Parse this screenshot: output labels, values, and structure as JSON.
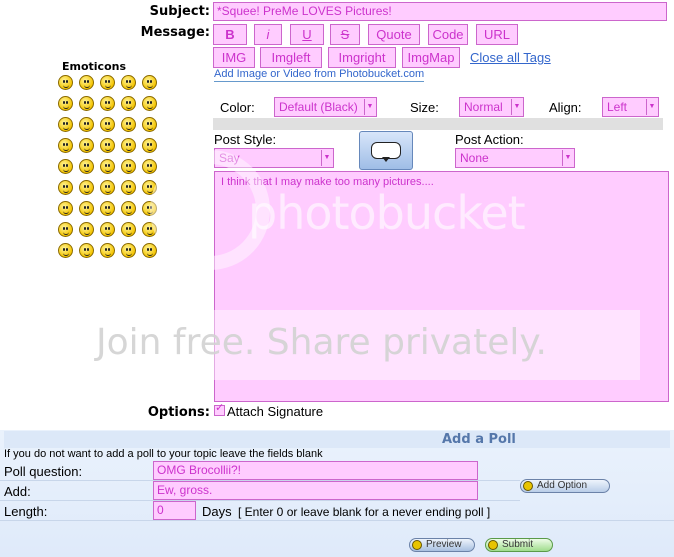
{
  "post": {
    "subject_label": "Subject:",
    "subject_value": "*Squee! PreMe LOVES Pictures!",
    "message_label": "Message:",
    "message_text": "I think that I may make too many pictures....",
    "options_label": "Options:",
    "attach_signature_label": "Attach Signature"
  },
  "tags": {
    "row1": [
      "B",
      "i",
      "U",
      "S",
      "Quote",
      "Code",
      "URL"
    ],
    "row2": [
      "IMG",
      "Imgleft",
      "Imgright",
      "ImgMap"
    ],
    "close_all_label": "Close all Tags",
    "photobucket_link": "Add Image or Video from Photobucket.com"
  },
  "format": {
    "color_label": "Color:",
    "color_value": "Default (Black)",
    "size_label": "Size:",
    "size_value": "Normal",
    "align_label": "Align:",
    "align_value": "Left"
  },
  "post_style": {
    "label": "Post Style:",
    "value": "Say",
    "action_label": "Post Action:",
    "action_value": "None"
  },
  "emoticons": {
    "title": "Emoticons",
    "rows": 9,
    "cols": 5,
    "last_row_count": 5
  },
  "watermark": {
    "line1": "photobucket",
    "line2": "Join free. Share privately."
  },
  "poll": {
    "title": "Add a Poll",
    "note": "If you do not want to add a poll to your topic leave the fields blank",
    "question_label": "Poll question:",
    "question_value": "OMG Brocollii?!",
    "add_label": "Add:",
    "add_value": "Ew, gross.",
    "add_option_label": "Add Option",
    "length_label": "Length:",
    "length_value": "0",
    "days_label": "Days",
    "days_hint": "[ Enter 0 or leave blank for a never ending poll ]"
  },
  "actions": {
    "preview_label": "Preview",
    "submit_label": "Submit"
  },
  "colors": {
    "field_bg": "#ffccff",
    "field_border": "#cc66cc",
    "field_text": "#cc33cc",
    "poll_header": "#dce8f8",
    "link": "#3366cc"
  }
}
